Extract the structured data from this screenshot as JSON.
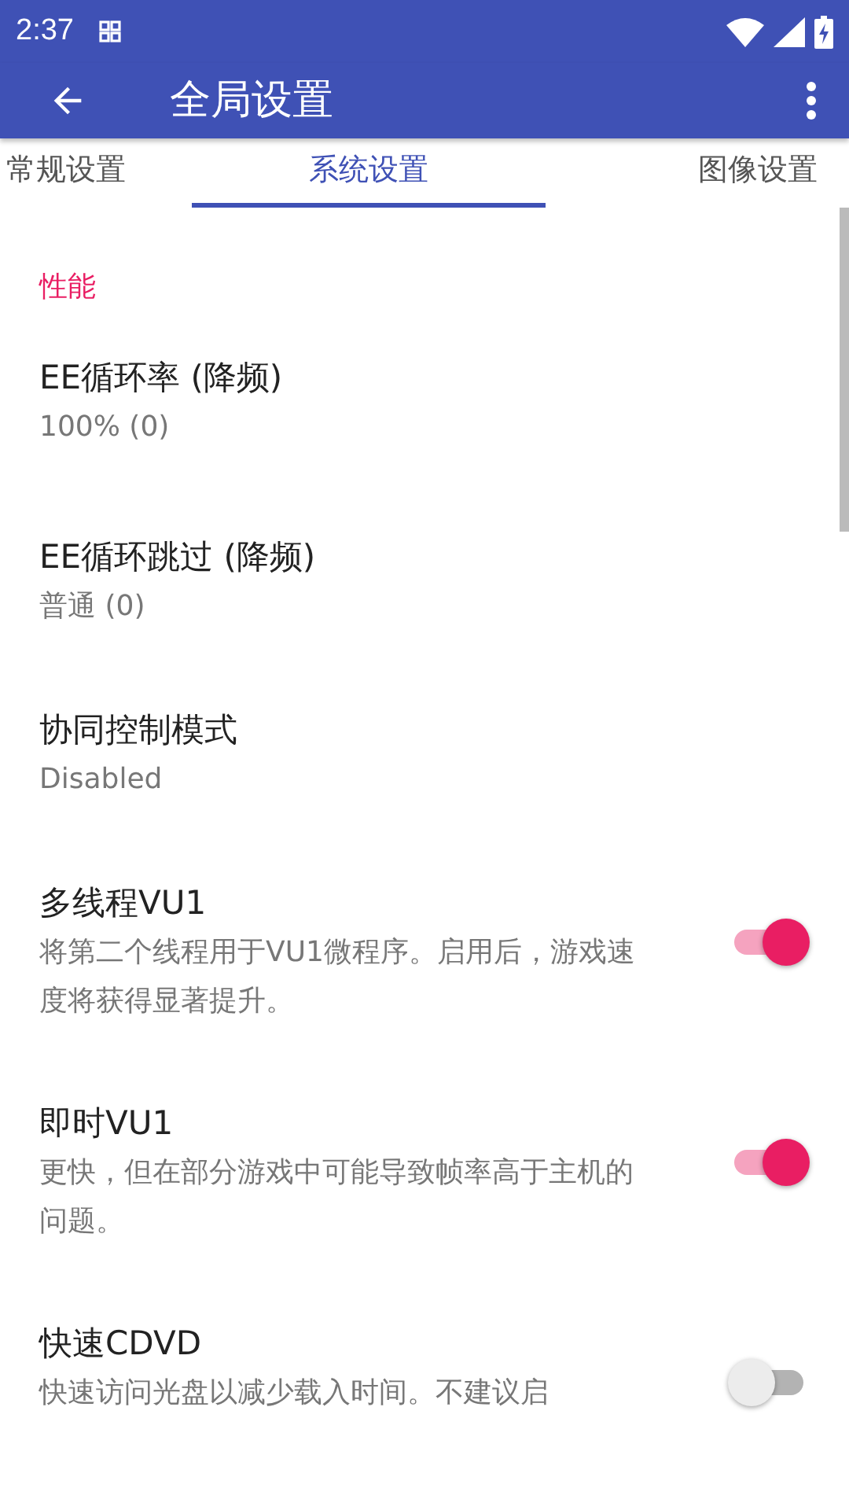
{
  "status_bar": {
    "time": "2:37"
  },
  "app_bar": {
    "title": "全局设置"
  },
  "tabs": [
    {
      "label": "常规设置",
      "selected": false
    },
    {
      "label": "系统设置",
      "selected": true
    },
    {
      "label": "图像设置",
      "selected": false
    }
  ],
  "section": {
    "title": "性能"
  },
  "settings": [
    {
      "kind": "value",
      "title": "EE循环率 (降频)",
      "summary": "100% (0)"
    },
    {
      "kind": "value",
      "title": "EE循环跳过 (降频)",
      "summary": "普通 (0)"
    },
    {
      "kind": "value",
      "title": "协同控制模式",
      "summary": "Disabled"
    },
    {
      "kind": "switch",
      "title": "多线程VU1",
      "summary": "将第二个线程用于VU1微程序。启用后，游戏速度将获得显著提升。",
      "on": true
    },
    {
      "kind": "switch",
      "title": "即时VU1",
      "summary": "更快，但在部分游戏中可能导致帧率高于主机的问题。",
      "on": true
    },
    {
      "kind": "switch",
      "title": "快速CDVD",
      "summary": "快速访问光盘以减少载入时间。不建议启",
      "on": false
    }
  ]
}
